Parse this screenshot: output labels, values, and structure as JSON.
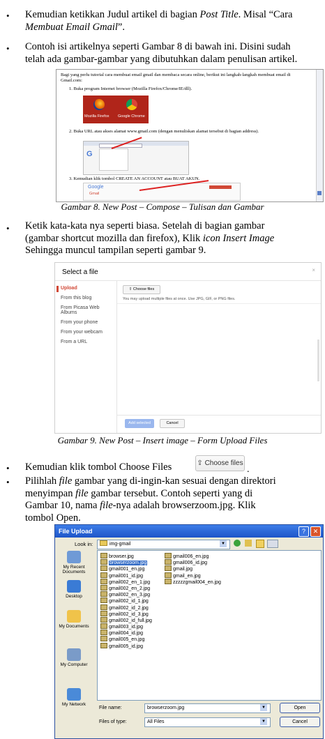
{
  "bullets": {
    "b1": {
      "line1_prefix": "Kemudian ketikkan Judul artikel di bagian ",
      "line1_em": "Post Title",
      "line1_suffix": ". Misal “Cara",
      "line2_em": "Membuat Email Gmail",
      "line2_suffix": "”."
    },
    "b2": {
      "line1": "Contoh isi artikelnya seperti Gambar 8 di bawah ini. Disini sudah",
      "line2": "telah ada gambar-gambar yang dibutuhkan dalam penulisan artikel."
    },
    "b3": {
      "line1_prefix": "Ketik kata-kata nya seperti biasa. Setelah di bagian gambar",
      "line2_prefix": "(gambar shortcut mozilla dan firefox), Klik ",
      "line2_em": "icon Insert Image",
      "line3": "Sehingga muncul tampilan seperti gambar 9."
    },
    "b4": {
      "text": "Kemudian klik tombol Choose Files",
      "suffix": "."
    },
    "b5": {
      "line1_prefix": "Pilihlah ",
      "line1_em": "file",
      "line1_suffix": " gambar yang di-ingin-kan sesuai dengan direktori",
      "line2_prefix": "menyimpan ",
      "line2_em": "file",
      "line2_suffix": " gambar tersebut. Contoh seperti yang di",
      "line3_prefix": "Gambar 10, nama ",
      "line3_em": "file",
      "line3_suffix": "-nya adalah browserzoom.jpg. Klik",
      "line4": "tombol Open."
    }
  },
  "captions": {
    "fig8": "Gambar 8. New Post – Compose – Tulisan dan Gambar",
    "fig9": "Gambar 9. New Post – Insert image – Form Upload Files"
  },
  "fig8": {
    "intro": "Bagi yang perlu tutorial cara membuat email gmail dan membaca secara online, berikut ini langkah-langkah membuat email di Gmail.com:",
    "step1": "1.  Buka program Internet browser (Mozilla Firefox/Chrome/IE/dll).",
    "icon1_label": "Mozilla Firefox",
    "icon2_label": "Google Chrome",
    "step2": "2.  Buka URL atau akses alamat www.gmail.com (dengan menuliskan alamat tersebut di bagian address).",
    "step3": "3.  Kemudian klik tombol CREATE AN ACCOUNT atau BUAT AKUN.",
    "google_logo": "Google",
    "gmail_label": "Gmail"
  },
  "fig9": {
    "title": "Select a file",
    "nav": [
      "Upload",
      "From this blog",
      "From Picasa Web Albums",
      "From your phone",
      "From your webcam",
      "From a URL"
    ],
    "choose_files": "Choose files",
    "hint": "You may upload multiple files at once. Use JPG, GIF, or PNG files.",
    "add_selected": "Add selected",
    "cancel": "Cancel"
  },
  "inline_button": {
    "label": "Choose files"
  },
  "fig10": {
    "title": "File Upload",
    "look_in_label": "Look in:",
    "look_in_value": "img-gmail",
    "places": [
      "My Recent Documents",
      "Desktop",
      "My Documents",
      "My Computer",
      "My Network"
    ],
    "files_col1": [
      "browser.jpg",
      "browserzoom.jpg",
      "gmail001_en.jpg",
      "gmail001_id.jpg",
      "gmail002_en_1.jpg",
      "gmail002_en_2.jpg",
      "gmail002_en_3.jpg",
      "gmail002_id_1.jpg",
      "gmail002_id_2.jpg",
      "gmail002_id_3.jpg",
      "gmail002_id_full.jpg",
      "gmail003_id.jpg",
      "gmail004_id.jpg",
      "gmail005_en.jpg",
      "gmail005_id.jpg"
    ],
    "files_col2": [
      "gmail006_en.jpg",
      "gmail006_id.jpg",
      "gmail.jpg",
      "gmail_en.jpg",
      "zzzzzgmail004_en.jpg"
    ],
    "selected_file": "browserzoom.jpg",
    "file_name_label": "File name:",
    "file_name_value": "browserzoom.jpg",
    "file_type_label": "Files of type:",
    "file_type_value": "All Files",
    "open": "Open",
    "cancel": "Cancel"
  },
  "colors": {
    "accent_red": "#d14836",
    "xp_blue": "#2a5fd4",
    "selection": "#316ac5"
  }
}
